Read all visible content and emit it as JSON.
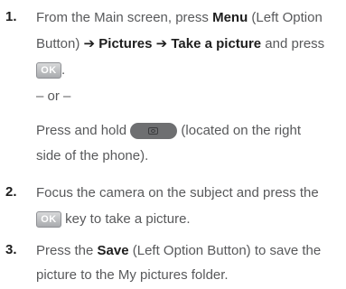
{
  "steps": [
    {
      "number": "1.",
      "line1": {
        "t1": "From the Main screen, press ",
        "b1": "Menu",
        "t2": " (Left Option"
      },
      "line2": {
        "t1": "Button) ",
        "b1": "➔ Pictures",
        "b2": " ➔ Take a picture",
        "t2": " and press"
      },
      "ok_key": "OK",
      "or_text": "– or –",
      "line4": {
        "t1": "Press and hold ",
        "t2": " (located on the right"
      },
      "line5": "side of the phone)."
    },
    {
      "number": "2.",
      "line1": "Focus the camera on the subject and press the",
      "ok_key": "OK",
      "line2_suffix": " key to take a picture."
    },
    {
      "number": "3.",
      "line1": {
        "t1": "Press the ",
        "b1": "Save",
        "t2": " (Left Option Button) to save the"
      },
      "line2": "picture to the My pictures folder."
    }
  ],
  "icons": {
    "ok_key": "ok-key-icon",
    "camera_key": "camera-key-icon"
  },
  "colors": {
    "body_text": "#58595b",
    "bold_text": "#1e1e1e"
  }
}
